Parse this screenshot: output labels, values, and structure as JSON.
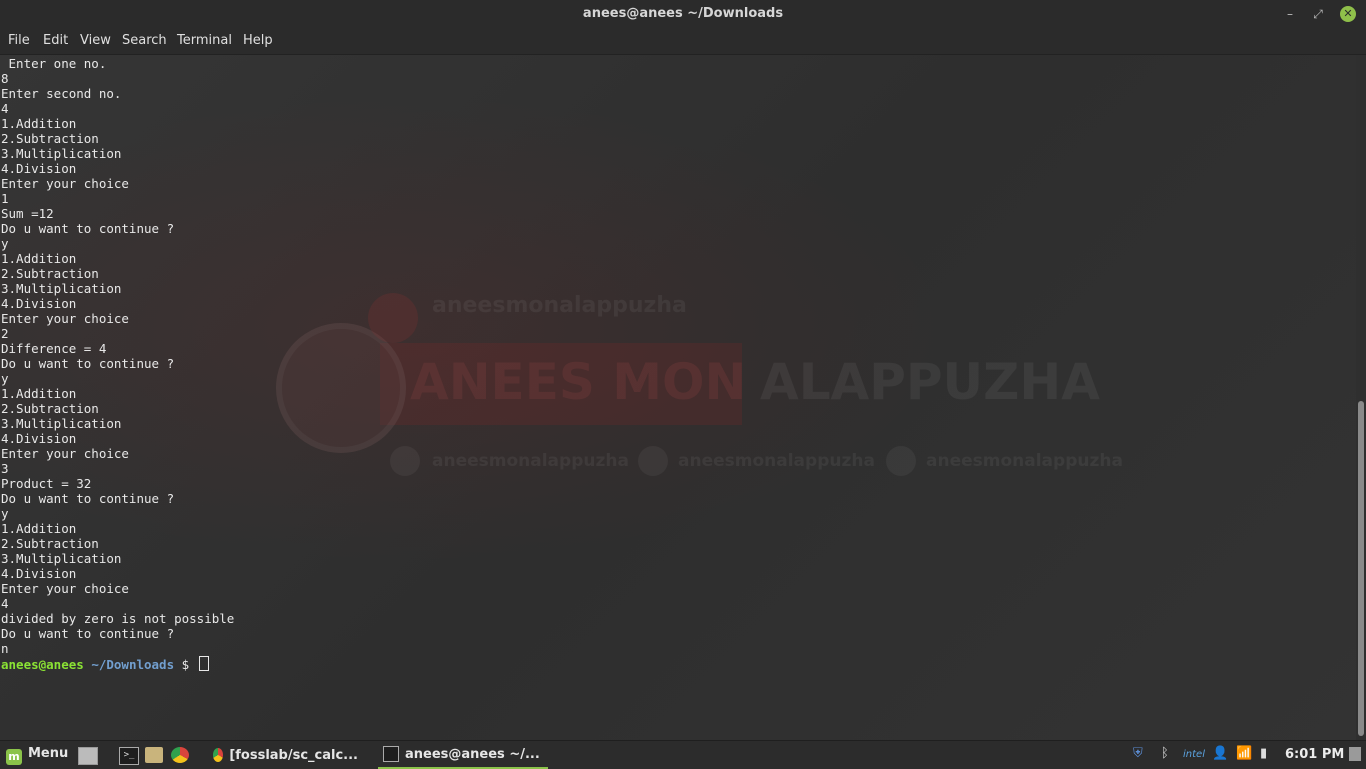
{
  "window": {
    "title": "anees@anees ~/Downloads",
    "controls": {
      "minimize": "–",
      "maximize": "⤢",
      "close": "✕"
    }
  },
  "menubar": {
    "items": [
      "File",
      "Edit",
      "View",
      "Search",
      "Terminal",
      "Help"
    ]
  },
  "terminal": {
    "output_lines": [
      " Enter one no.",
      "8",
      "Enter second no.",
      "4",
      "1.Addition",
      "2.Subtraction",
      "3.Multiplication",
      "4.Division",
      "Enter your choice",
      "1",
      "Sum =12",
      "Do u want to continue ?",
      "y",
      "1.Addition",
      "2.Subtraction",
      "3.Multiplication",
      "4.Division",
      "Enter your choice",
      "2",
      "Difference = 4",
      "Do u want to continue ?",
      "y",
      "1.Addition",
      "2.Subtraction",
      "3.Multiplication",
      "4.Division",
      "Enter your choice",
      "3",
      "Product = 32",
      "Do u want to continue ?",
      "y",
      "1.Addition",
      "2.Subtraction",
      "3.Multiplication",
      "4.Division",
      "Enter your choice",
      "4",
      "divided by zero is not possible",
      "Do u want to continue ?",
      "n"
    ],
    "prompt": {
      "user": "anees@anees",
      "path": " ~/Downloads",
      "symbol": " $ "
    }
  },
  "wallpaper": {
    "channel": "aneesmonalappuzha",
    "banner_left": "ANEES MON",
    "banner_right": "ALAPPUZHA",
    "social_1": "aneesmonalappuzha",
    "social_2": "aneesmonalappuzha",
    "social_3": "aneesmonalappuzha"
  },
  "taskbar": {
    "menu_label": "Menu",
    "tasks": [
      "[fosslab/sc_calc...",
      "anees@anees ~/..."
    ],
    "tray": {
      "intel": "intel"
    },
    "clock": "6:01 PM"
  },
  "colors": {
    "prompt_user": "#8ae234",
    "prompt_path": "#729fcf",
    "accent": "#8bc34a"
  }
}
